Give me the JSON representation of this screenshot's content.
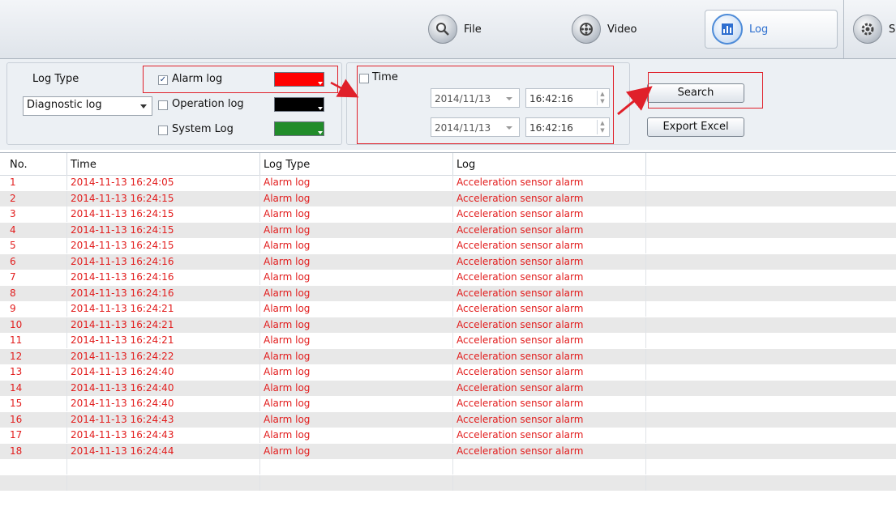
{
  "toolbar": {
    "tabs": [
      {
        "label": "File",
        "icon": "file-search-icon"
      },
      {
        "label": "Video",
        "icon": "video-reel-icon"
      },
      {
        "label": "Log",
        "icon": "log-chart-icon"
      },
      {
        "label": "S",
        "icon": "settings-icon"
      }
    ],
    "active_tab": "Log"
  },
  "filters": {
    "log_type_label": "Log Type",
    "log_type_select": "Diagnostic log",
    "types": [
      {
        "label": "Alarm log",
        "checked": true,
        "color": "#ff0000"
      },
      {
        "label": "Operation log",
        "checked": false,
        "color": "#000000"
      },
      {
        "label": "System Log",
        "checked": false,
        "color": "#218c2a"
      }
    ],
    "time_label": "Time",
    "time_checked": false,
    "start_date": "2014/11/13",
    "start_time": "16:42:16",
    "end_date": "2014/11/13",
    "end_time": "16:42:16",
    "search_label": "Search",
    "export_label": "Export Excel"
  },
  "table": {
    "columns": [
      "No.",
      "Time",
      "Log Type",
      "Log"
    ],
    "rows": [
      [
        "1",
        "2014-11-13 16:24:05",
        "Alarm log",
        "Acceleration sensor alarm"
      ],
      [
        "2",
        "2014-11-13 16:24:15",
        "Alarm log",
        "Acceleration sensor alarm"
      ],
      [
        "3",
        "2014-11-13 16:24:15",
        "Alarm log",
        "Acceleration sensor alarm"
      ],
      [
        "4",
        "2014-11-13 16:24:15",
        "Alarm log",
        "Acceleration sensor alarm"
      ],
      [
        "5",
        "2014-11-13 16:24:15",
        "Alarm log",
        "Acceleration sensor alarm"
      ],
      [
        "6",
        "2014-11-13 16:24:16",
        "Alarm log",
        "Acceleration sensor alarm"
      ],
      [
        "7",
        "2014-11-13 16:24:16",
        "Alarm log",
        "Acceleration sensor alarm"
      ],
      [
        "8",
        "2014-11-13 16:24:16",
        "Alarm log",
        "Acceleration sensor alarm"
      ],
      [
        "9",
        "2014-11-13 16:24:21",
        "Alarm log",
        "Acceleration sensor alarm"
      ],
      [
        "10",
        "2014-11-13 16:24:21",
        "Alarm log",
        "Acceleration sensor alarm"
      ],
      [
        "11",
        "2014-11-13 16:24:21",
        "Alarm log",
        "Acceleration sensor alarm"
      ],
      [
        "12",
        "2014-11-13 16:24:22",
        "Alarm log",
        "Acceleration sensor alarm"
      ],
      [
        "13",
        "2014-11-13 16:24:40",
        "Alarm log",
        "Acceleration sensor alarm"
      ],
      [
        "14",
        "2014-11-13 16:24:40",
        "Alarm log",
        "Acceleration sensor alarm"
      ],
      [
        "15",
        "2014-11-13 16:24:40",
        "Alarm log",
        "Acceleration sensor alarm"
      ],
      [
        "16",
        "2014-11-13 16:24:43",
        "Alarm log",
        "Acceleration sensor alarm"
      ],
      [
        "17",
        "2014-11-13 16:24:43",
        "Alarm log",
        "Acceleration sensor alarm"
      ],
      [
        "18",
        "2014-11-13 16:24:44",
        "Alarm log",
        "Acceleration sensor alarm"
      ]
    ],
    "row_text_color": "#e21d1d"
  },
  "annotation_color": "#e0202a"
}
